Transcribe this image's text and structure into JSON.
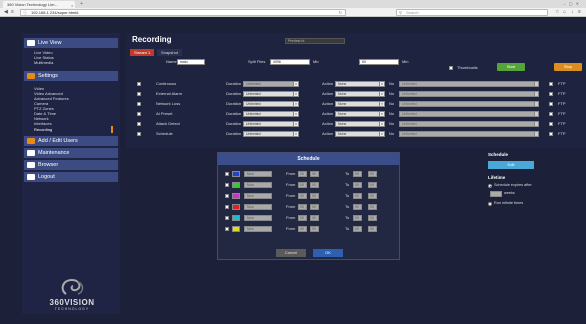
{
  "browser": {
    "tab_title": "360 Vision Technology Lim...",
    "tab_close": "×",
    "new_tab": "+",
    "window_controls": "–  ▢  ✕",
    "url": "192.168.1.234/super.html#",
    "search_placeholder": "Search"
  },
  "sidebar": {
    "live_view": "Live View",
    "live_items": [
      "Live Video",
      "Live Status",
      "Multimedia"
    ],
    "settings": "Settings",
    "settings_items": [
      "Video",
      "Video Advanced",
      "Advanced Features",
      "Camera",
      "PTZ Zones",
      "Date & Time",
      "Network",
      "Interfaces",
      "Recording"
    ],
    "add_edit_users": "Add / Edit Users",
    "maintenance": "Maintenance",
    "browser": "Browser",
    "logout": "Logout",
    "logo_main": "360VISION",
    "logo_sub": "TECHNOLOGY"
  },
  "recording": {
    "title": "Recording",
    "preview_label": "Preview Id",
    "tabs": [
      "Stream 1",
      "Snapshot"
    ],
    "name_label": "Name",
    "name_value": "main",
    "split_files_label": "Split Files",
    "split_files_value": "4096",
    "mb_unit": "Mb",
    "min_value": "60",
    "min_unit": "Min",
    "thumbnails_label": "Thumbnails",
    "start_label": "Start",
    "stop_label": "Stop",
    "duration_label": "Duration",
    "action_label": "Action",
    "no_label": "No",
    "ftp_label": "FTP",
    "rows": [
      {
        "name": "Continuous",
        "duration": "Unlimited",
        "action": "None",
        "no": "Unlimited"
      },
      {
        "name": "External Alarm",
        "duration": "Unlimited",
        "action": "None",
        "no": "Unlimited"
      },
      {
        "name": "Network Loss",
        "duration": "Unlimited",
        "action": "None",
        "no": "Unlimited"
      },
      {
        "name": "At Preset",
        "duration": "Unlimited",
        "action": "None",
        "no": "Unlimited"
      },
      {
        "name": "Attack Detect",
        "duration": "Unlimited",
        "action": "None",
        "no": "Unlimited"
      },
      {
        "name": "Schedule",
        "duration": "Unlimited",
        "action": "None",
        "no": "Unlimited"
      }
    ]
  },
  "schedule": {
    "title": "Schedule",
    "from_label": "From",
    "to_label": "To",
    "rows": [
      {
        "color": "#2244cc",
        "day": "Mon",
        "from_h": "00",
        "from_m": "00",
        "to_h": "00",
        "to_m": "00"
      },
      {
        "color": "#33cc33",
        "day": "Mon",
        "from_h": "00",
        "from_m": "00",
        "to_h": "00",
        "to_m": "00"
      },
      {
        "color": "#cc33cc",
        "day": "Mon",
        "from_h": "00",
        "from_m": "00",
        "to_h": "00",
        "to_m": "00"
      },
      {
        "color": "#dd2222",
        "day": "Mon",
        "from_h": "00",
        "from_m": "00",
        "to_h": "00",
        "to_m": "00"
      },
      {
        "color": "#22bbcc",
        "day": "Mon",
        "from_h": "00",
        "from_m": "00",
        "to_h": "00",
        "to_m": "00"
      },
      {
        "color": "#dddd22",
        "day": "Mon",
        "from_h": "00",
        "from_m": "00",
        "to_h": "00",
        "to_m": "00"
      }
    ],
    "cancel_label": "Cancel",
    "ok_label": "OK"
  },
  "right_panel": {
    "schedule_title": "Schedule",
    "edit_label": "Edit",
    "lifetime_title": "Lifetime",
    "expire_label": "Schedule expires after",
    "weeks_label": "weeks",
    "infinite_label": "Run infinite times"
  }
}
